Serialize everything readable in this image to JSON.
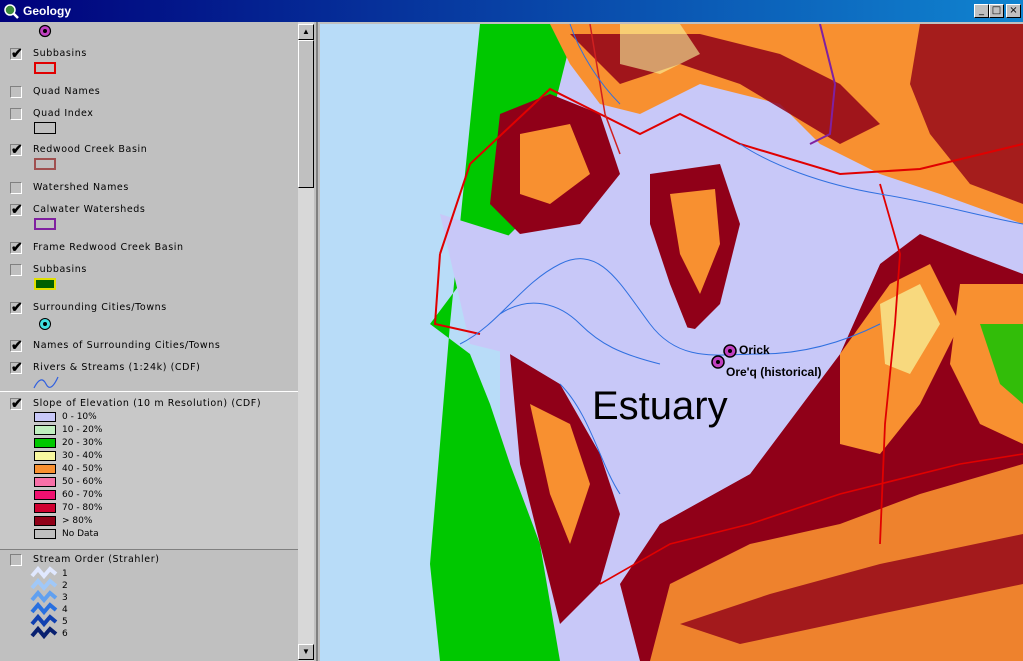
{
  "window": {
    "title": "Geology",
    "minimize_glyph": "_",
    "maximize_glyph": "□",
    "close_glyph": "×"
  },
  "toc": {
    "layers": [
      {
        "name": "Subbasins",
        "checked": true
      },
      {
        "name": "Quad Names",
        "checked": false
      },
      {
        "name": "Quad Index",
        "checked": false
      },
      {
        "name": "Redwood Creek Basin",
        "checked": true
      },
      {
        "name": "Watershed Names",
        "checked": false
      },
      {
        "name": "Calwater Watersheds",
        "checked": true
      },
      {
        "name": "Frame Redwood Creek Basin",
        "checked": true
      },
      {
        "name": "Subbasins",
        "checked": false
      },
      {
        "name": "Surrounding Cities/Towns",
        "checked": true
      },
      {
        "name": "Names of Surrounding Cities/Towns",
        "checked": true
      },
      {
        "name": "Rivers & Streams (1:24k) (CDF)",
        "checked": true
      },
      {
        "name": "Slope of Elevation (10 m Resolution) (CDF)",
        "checked": true
      },
      {
        "name": "Stream Order (Strahler)",
        "checked": false
      }
    ],
    "check_glyph": "✔",
    "slope_classes": [
      {
        "label": "0 - 10%",
        "color": "#c8c8f8"
      },
      {
        "label": "10 - 20%",
        "color": "#c0f0c0"
      },
      {
        "label": "20 - 30%",
        "color": "#00c800"
      },
      {
        "label": "30 - 40%",
        "color": "#f8f8a0"
      },
      {
        "label": "40 - 50%",
        "color": "#f89030"
      },
      {
        "label": "50 - 60%",
        "color": "#f870a8"
      },
      {
        "label": "60 - 70%",
        "color": "#f01070"
      },
      {
        "label": "70 - 80%",
        "color": "#d00030"
      },
      {
        "label": "> 80%",
        "color": "#900018"
      },
      {
        "label": "No Data",
        "color": "#c0c0c0"
      }
    ],
    "stream_orders": [
      "1",
      "2",
      "3",
      "4",
      "5",
      "6"
    ]
  },
  "map": {
    "places": [
      {
        "name": "Orick"
      },
      {
        "name": "Ore'q (historical)"
      }
    ],
    "label": "Estuary"
  }
}
